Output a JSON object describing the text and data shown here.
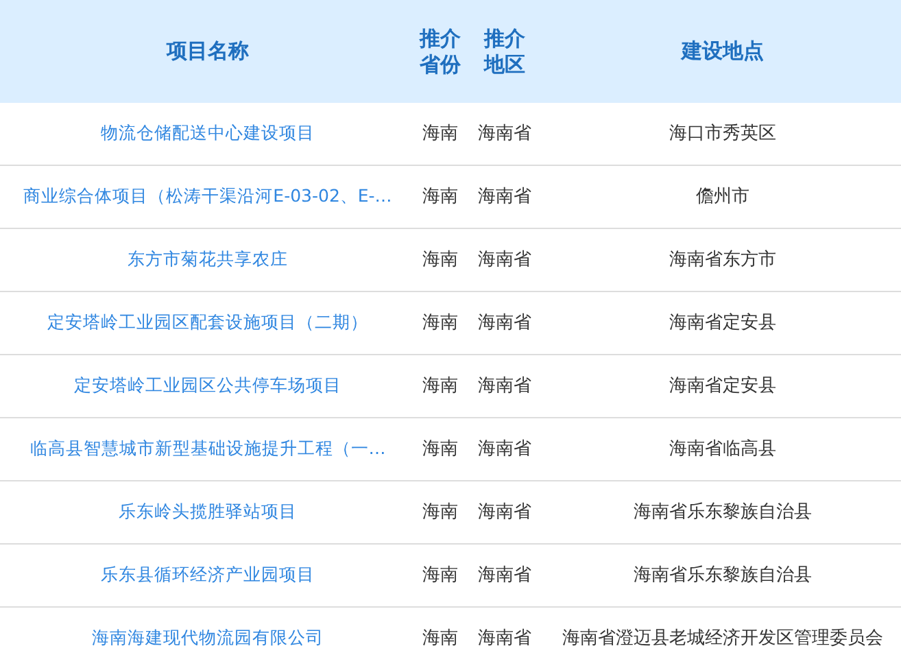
{
  "table": {
    "columns": [
      "项目名称",
      "推介省份",
      "推介地区",
      "建设地点"
    ],
    "rows": [
      {
        "name": "物流仓储配送中心建设项目",
        "province": "海南",
        "region": "海南省",
        "location": "海口市秀英区"
      },
      {
        "name": "商业综合体项目（松涛干渠沿河E-03-02、E-…",
        "province": "海南",
        "region": "海南省",
        "location": "儋州市"
      },
      {
        "name": "东方市菊花共享农庄",
        "province": "海南",
        "region": "海南省",
        "location": "海南省东方市"
      },
      {
        "name": "定安塔岭工业园区配套设施项目（二期）",
        "province": "海南",
        "region": "海南省",
        "location": "海南省定安县"
      },
      {
        "name": "定安塔岭工业园区公共停车场项目",
        "province": "海南",
        "region": "海南省",
        "location": "海南省定安县"
      },
      {
        "name": "临高县智慧城市新型基础设施提升工程（一…",
        "province": "海南",
        "region": "海南省",
        "location": "海南省临高县"
      },
      {
        "name": "乐东岭头揽胜驿站项目",
        "province": "海南",
        "region": "海南省",
        "location": "海南省乐东黎族自治县"
      },
      {
        "name": "乐东县循环经济产业园项目",
        "province": "海南",
        "region": "海南省",
        "location": "海南省乐东黎族自治县"
      },
      {
        "name": "海南海建现代物流园有限公司",
        "province": "海南",
        "region": "海南省",
        "location": "海南省澄迈县老城经济开发区管理委员会"
      }
    ]
  }
}
